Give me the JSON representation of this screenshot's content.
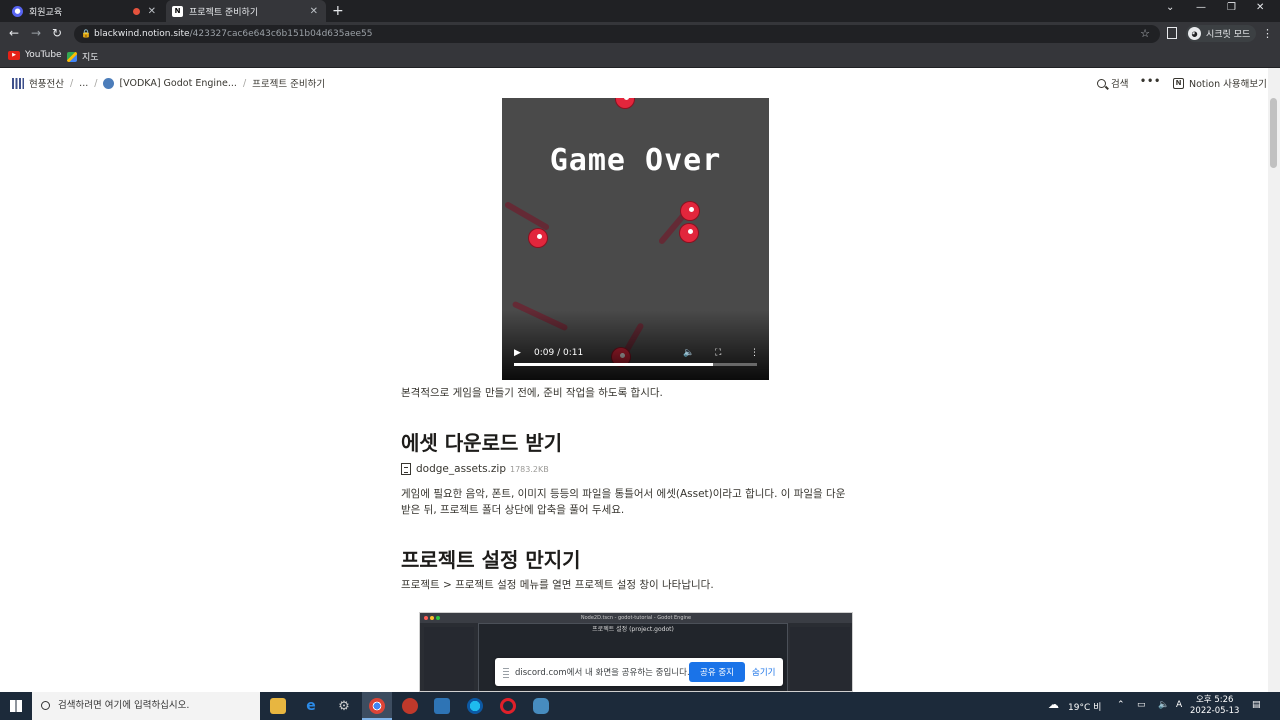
{
  "browser": {
    "tabs": [
      {
        "title": "회원교육",
        "active": false
      },
      {
        "title": "프로젝트 준비하기",
        "active": true
      }
    ],
    "url_host": "blackwind.notion.site",
    "url_path": "/423327cac6e643c6b151b04d635aee55",
    "profile_label": "시크릿 모드",
    "bookmarks": [
      {
        "label": "YouTube",
        "icon": "youtube-icon"
      },
      {
        "label": "지도",
        "icon": "maps-icon"
      }
    ]
  },
  "notion": {
    "breadcrumbs": [
      "현풍전산",
      "...",
      "[VODKA] Godot Engine...",
      "프로젝트 준비하기"
    ],
    "search_label": "검색",
    "try_notion_label": "Notion 사용해보기"
  },
  "video": {
    "overlay_text": "Game Over",
    "time": "0:09 / 0:11",
    "progress": 0.82
  },
  "content": {
    "intro": "본격적으로 게임을 만들기 전에, 준비 작업을 하도록 합시다.",
    "h_assets": "에셋 다운로드 받기",
    "file_name": "dodge_assets.zip",
    "file_size": "1783.2KB",
    "assets_para_1": "게임에 필요한 음악, 폰트, 이미지 등등의 파일을 통틀어서 에셋(Asset)이라고 합니다. 이 파일을 다운",
    "assets_para_2": "받은 뒤, 프로젝트 폴더 상단에 압축을 풀어 두세요.",
    "h_project": "프로젝트 설정 만지기",
    "project_para": "프로젝트 > 프로젝트 설정 메뉴를 열면 프로젝트 설정 창이 나타납니다."
  },
  "screenshot": {
    "window_title": "Node2D.tscn - godot-tutorial - Godot Engine",
    "dialog_title": "프로젝트 설정 (project.godot)"
  },
  "share_bar": {
    "message": "discord.com에서 내 화면을 공유하는 중입니다.",
    "stop_label": "공유 중지",
    "hide_label": "숨기기"
  },
  "taskbar": {
    "search_placeholder": "검색하려면 여기에 입력하십시오.",
    "weather": "19°C 비",
    "time": "오후 5:26",
    "date": "2022-05-13"
  }
}
